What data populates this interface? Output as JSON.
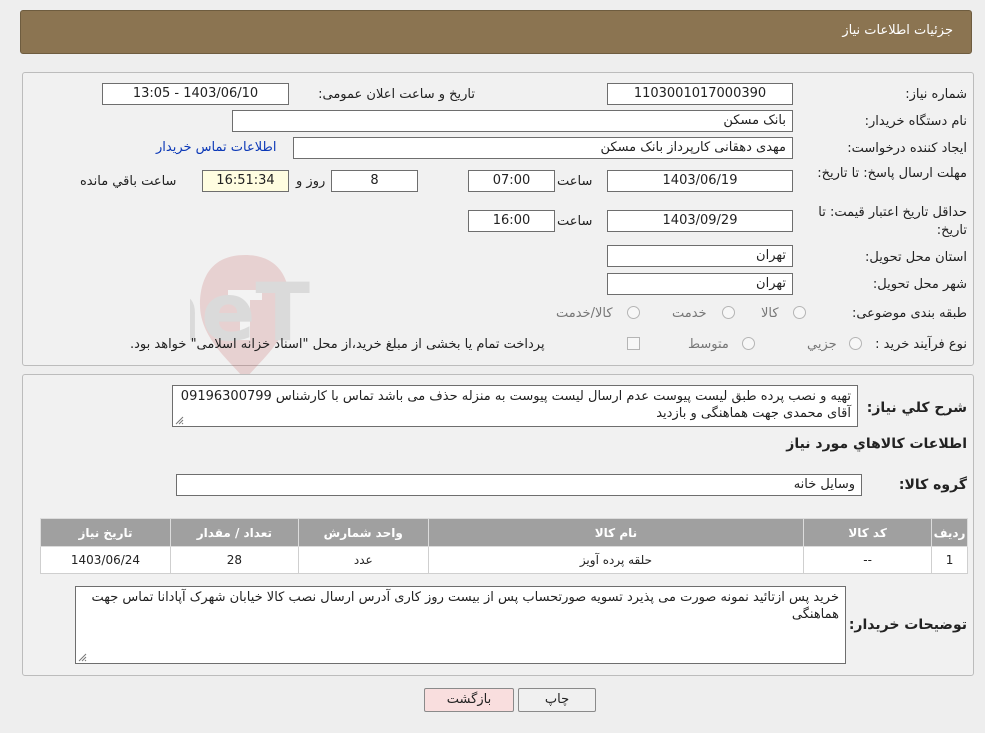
{
  "header": {
    "title": "جزئیات اطلاعات نیاز"
  },
  "form": {
    "need_number": {
      "label": "شماره نیاز:",
      "value": "1103001017000390"
    },
    "announce_datetime": {
      "label": "تاریخ و ساعت اعلان عمومی:",
      "value": "1403/06/10 - 13:05"
    },
    "buyer_org": {
      "label": "نام دستگاه خریدار:",
      "value": "بانک مسکن"
    },
    "creator": {
      "label": "ایجاد کننده درخواست:",
      "value": "مهدی دهقانی کارپرداز بانک مسکن",
      "contact_link": "اطلاعات تماس خریدار"
    },
    "reply_deadline": {
      "label": "مهلت ارسال پاسخ: تا تاریخ:",
      "date": "1403/06/19",
      "time_label": "ساعت",
      "time": "07:00",
      "days": "8",
      "days_label": "روز و",
      "remaining": "16:51:34",
      "remaining_label": "ساعت باقي مانده"
    },
    "price_validity": {
      "label": "حداقل تاریخ اعتبار قیمت: تا تاریخ:",
      "date": "1403/09/29",
      "time_label": "ساعت",
      "time": "16:00"
    },
    "delivery_province": {
      "label": "استان محل تحویل:",
      "value": "تهران"
    },
    "delivery_city": {
      "label": "شهر محل تحویل:",
      "value": "تهران"
    },
    "category": {
      "label": "طبقه بندی موضوعی:",
      "options": [
        "کالا",
        "خدمت",
        "کالا/خدمت"
      ]
    },
    "purchase_process": {
      "label": "نوع فرآیند خرید :",
      "options": [
        "جزیي",
        "متوسط"
      ],
      "note": "پرداخت تمام یا بخشی از مبلغ خرید،از محل \"اسناد خزانه اسلامی\" خواهد بود."
    }
  },
  "description": {
    "label": "شرح کلي نياز:",
    "text": "تهیه و نصب پرده  طبق لیست پیوست عدم ارسال لیست پیوست به منزله حذف می باشد تماس با کارشناس 09196300799 آقای محمدی جهت هماهنگی و بازدید"
  },
  "goods": {
    "section_title": "اطلاعات کالاهاي مورد نياز",
    "group_label": "گروه کالا:",
    "group_value": "وسایل خانه",
    "table": {
      "headers": [
        "ردیف",
        "کد کالا",
        "نام کالا",
        "واحد شمارش",
        "تعداد / مقدار",
        "تاریخ نیاز"
      ],
      "rows": [
        [
          "1",
          "--",
          "حلقه پرده آویز",
          "عدد",
          "28",
          "1403/06/24"
        ]
      ]
    }
  },
  "buyer_notes": {
    "label": "توضیحات خریدار:",
    "text": "خرید پس ازتائید نمونه صورت می پذیرد تسویه صورتحساب پس از بیست روز کاری آدرس ارسال نصب کالا خیابان شهرک آپادانا تماس جهت هماهنگی"
  },
  "buttons": {
    "print": "چاپ",
    "back": "بازگشت"
  },
  "colors": {
    "header": "#8b7451",
    "table_header": "#a0a0a0",
    "back_button": "#f9dede",
    "link": "#0b38b7"
  }
}
